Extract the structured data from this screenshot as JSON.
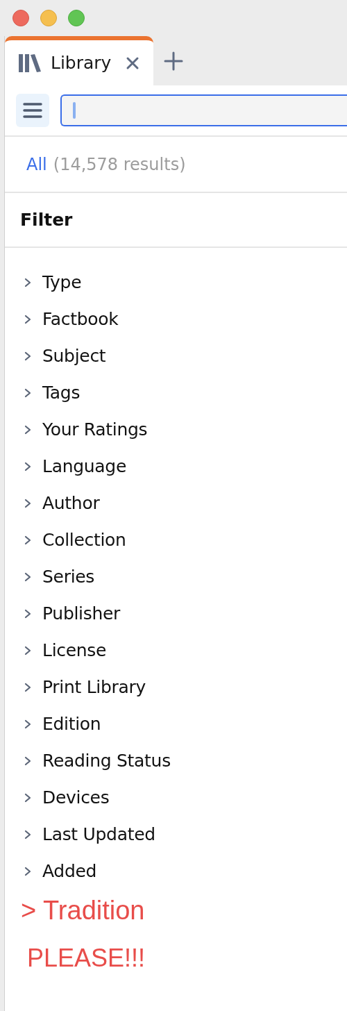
{
  "tabs": [
    {
      "label": "Library",
      "selected": true
    }
  ],
  "results": {
    "scope": "All",
    "count": "(14,578 results)"
  },
  "filter": {
    "title": "Filter",
    "items": [
      {
        "label": "Type",
        "expanded": false
      },
      {
        "label": "Factbook",
        "expanded": false
      },
      {
        "label": "Subject",
        "expanded": false
      },
      {
        "label": "Tags",
        "expanded": false
      },
      {
        "label": "Your Ratings",
        "expanded": false
      },
      {
        "label": "Language",
        "expanded": false
      },
      {
        "label": "Author",
        "expanded": false
      },
      {
        "label": "Collection",
        "expanded": false
      },
      {
        "label": "Series",
        "expanded": false
      },
      {
        "label": "Publisher",
        "expanded": false
      },
      {
        "label": "License",
        "expanded": false
      },
      {
        "label": "Print Library",
        "expanded": false
      },
      {
        "label": "Edition",
        "expanded": false
      },
      {
        "label": "Reading Status",
        "expanded": false
      },
      {
        "label": "Devices",
        "expanded": false
      },
      {
        "label": "Last Updated",
        "expanded": false
      },
      {
        "label": "Added",
        "expanded": false
      }
    ]
  },
  "annotations": [
    {
      "text": "> Tradition",
      "kind": "heading"
    },
    {
      "text": "PLEASE!!!",
      "kind": "note"
    }
  ]
}
